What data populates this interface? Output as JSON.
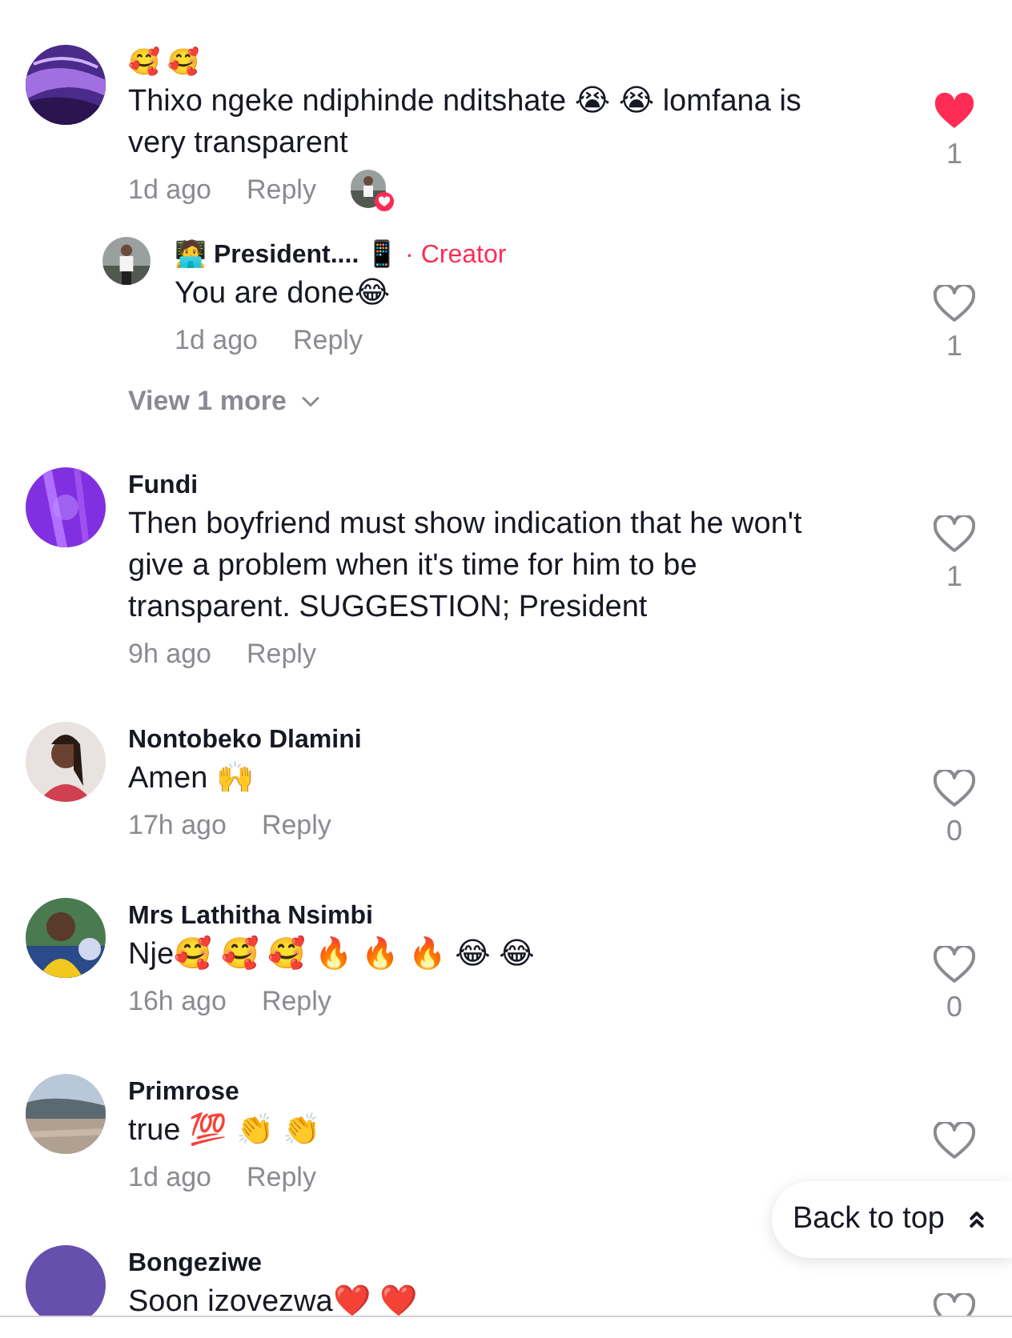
{
  "comments": [
    {
      "name": "🥰 🥰",
      "text": "Thixo ngeke ndiphinde nditshate 😭 😭 lomfana is very transparent",
      "time": "1d ago",
      "reply": "Reply",
      "liked": true,
      "likes": "1",
      "creator_liked": true,
      "replies": [
        {
          "name": "🧑‍💻 President.... 📱",
          "tag": "· Creator",
          "text": "You are done😂",
          "time": "1d ago",
          "reply": "Reply",
          "liked": false,
          "likes": "1"
        }
      ],
      "more": "View 1 more"
    },
    {
      "name": "Fundi",
      "text": "Then boyfriend must show indication that he won't give a problem when it's time for him to be transparent. SUGGESTION; President",
      "time": "9h ago",
      "reply": "Reply",
      "liked": false,
      "likes": "1"
    },
    {
      "name": "Nontobeko Dlamini",
      "text": "Amen 🙌",
      "time": "17h ago",
      "reply": "Reply",
      "liked": false,
      "likes": "0"
    },
    {
      "name": "Mrs Lathitha Nsimbi",
      "text": "Nje🥰 🥰 🥰 🔥 🔥 🔥 😂 😂",
      "time": "16h ago",
      "reply": "Reply",
      "liked": false,
      "likes": "0"
    },
    {
      "name": "Primrose",
      "text": "true 💯 👏 👏",
      "time": "1d ago",
      "reply": "Reply",
      "liked": false
    },
    {
      "name": "Bongeziwe",
      "text": "Soon izovezwa❤️ ❤️",
      "liked": false
    }
  ],
  "back_to_top": "Back to top"
}
